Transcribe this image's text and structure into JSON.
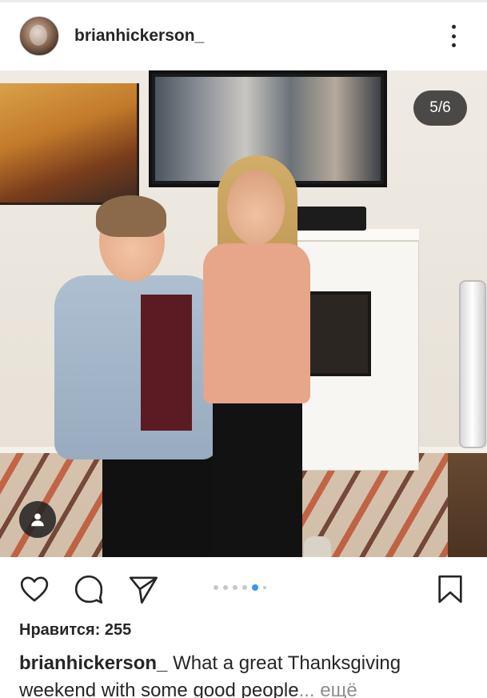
{
  "post": {
    "username": "brianhickerson_",
    "photo_counter": "5/6",
    "carousel": {
      "total_dots": 6,
      "active_index": 4
    },
    "likes_text": "Нравится: 255",
    "caption_text": "What a great Thanksgiving weekend with some good people",
    "caption_more": "... ещё"
  },
  "icons": {
    "more": "more-vertical-icon",
    "tag": "user-tag-icon",
    "like": "heart-icon",
    "comment": "comment-icon",
    "share": "send-icon",
    "save": "bookmark-icon"
  },
  "colors": {
    "text": "#262626",
    "muted": "#8e8e8e",
    "carousel_active": "#3897f0",
    "carousel_inactive": "#c7c7c7"
  }
}
